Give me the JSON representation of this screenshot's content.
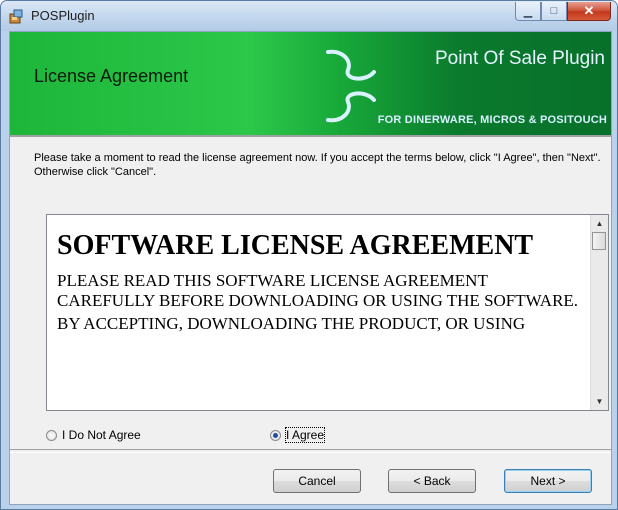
{
  "window": {
    "title": "POSPlugin",
    "minimize_glyph": "▁",
    "maximize_glyph": "□",
    "close_glyph": "✕"
  },
  "banner": {
    "title": "License Agreement",
    "product_name": "Point Of Sale Plugin",
    "subtitle": "FOR DINERWARE, MICROS & POSITOUCH",
    "colors": {
      "green": "#1db63a",
      "dark_green": "#08702a"
    }
  },
  "instructions": "Please take a moment to read the license agreement now. If you accept the terms below, click \"I Agree\", then \"Next\". Otherwise click \"Cancel\".",
  "license": {
    "heading": "SOFTWARE LICENSE AGREEMENT",
    "paragraphs": [
      "PLEASE READ THIS SOFTWARE LICENSE AGREEMENT CAREFULLY BEFORE DOWNLOADING OR USING THE SOFTWARE.",
      "BY ACCEPTING, DOWNLOADING THE PRODUCT, OR USING"
    ],
    "scroll_up_icon": "▲",
    "scroll_down_icon": "▼"
  },
  "options": {
    "do_not_agree": "I Do Not Agree",
    "agree": "I Agree",
    "selected": "agree"
  },
  "buttons": {
    "cancel": "Cancel",
    "back": "< Back",
    "next": "Next >"
  }
}
